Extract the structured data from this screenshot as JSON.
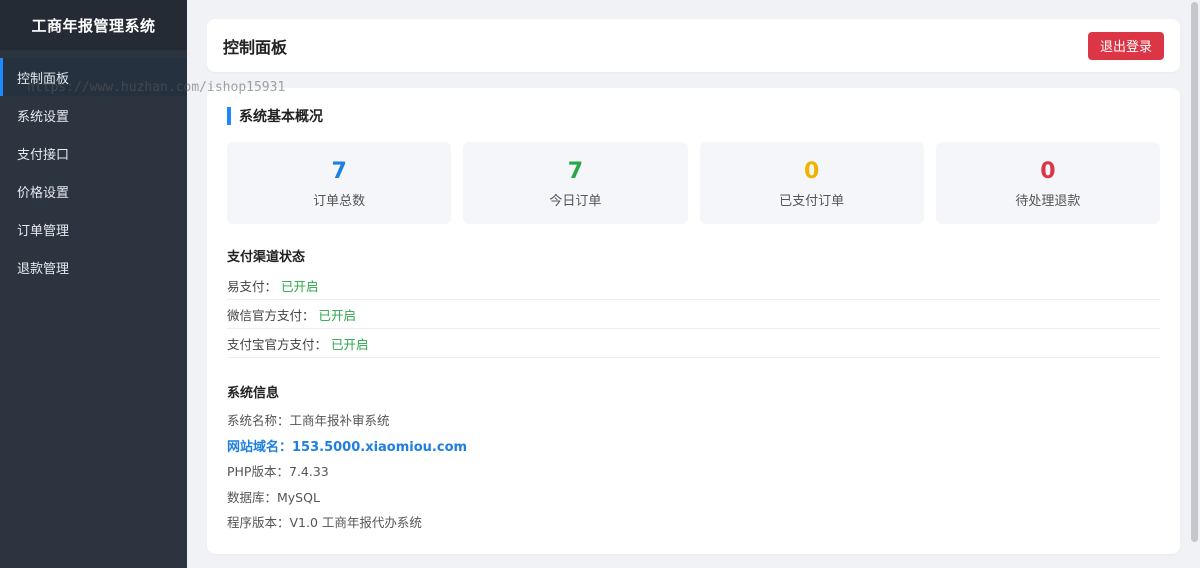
{
  "app": {
    "title": "工商年报管理系统"
  },
  "sidebar": {
    "items": [
      {
        "label": "控制面板"
      },
      {
        "label": "系统设置"
      },
      {
        "label": "支付接口"
      },
      {
        "label": "价格设置"
      },
      {
        "label": "订单管理"
      },
      {
        "label": "退款管理"
      }
    ]
  },
  "header": {
    "title": "控制面板",
    "logout_label": "退出登录"
  },
  "overview": {
    "title": "系统基本概况",
    "stats": [
      {
        "value": "7",
        "label": "订单总数",
        "color": "#1e7fe0"
      },
      {
        "value": "7",
        "label": "今日订单",
        "color": "#28a745"
      },
      {
        "value": "0",
        "label": "已支付订单",
        "color": "#f0b400"
      },
      {
        "value": "0",
        "label": "待处理退款",
        "color": "#dc3545"
      }
    ]
  },
  "payment": {
    "title": "支付渠道状态",
    "channels": [
      {
        "name": "易支付：",
        "status": "已开启"
      },
      {
        "name": "微信官方支付：",
        "status": "已开启"
      },
      {
        "name": "支付宝官方支付：",
        "status": "已开启"
      }
    ]
  },
  "system": {
    "title": "系统信息",
    "rows": [
      "系统名称：工商年报补审系统",
      "网站域名：153.5000.xiaomiou.com",
      "PHP版本：7.4.33",
      "数据库：MySQL",
      "程序版本：V1.0 工商年报代办系统"
    ]
  },
  "watermark": "https://www.huzhan.com/ishop15931",
  "colors": {
    "accent": "#1e88ff",
    "danger": "#dc3545",
    "success": "#28a745",
    "sidebar": "#2c3440"
  }
}
